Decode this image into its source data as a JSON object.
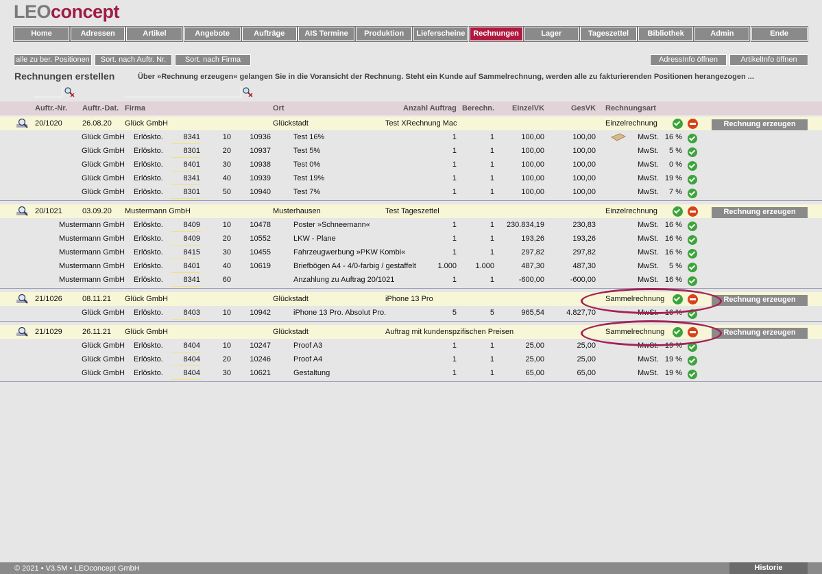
{
  "brand": {
    "part1": "LEO",
    "part2": "concept"
  },
  "nav": [
    "Home",
    "Adressen",
    "Artikel",
    "Angebote",
    "Aufträge",
    "AIS Termine",
    "Produktion",
    "Lieferscheine",
    "Rechnungen",
    "Lager",
    "Tageszettel",
    "Bibliothek",
    "Admin",
    "Ende"
  ],
  "active_tab": "Rechnungen",
  "toolbar": {
    "b1": "alle zu ber. Positionen",
    "b2": "Sort. nach Auftr. Nr.",
    "b3": "Sort. nach Firma",
    "b4": "AdressInfo öffnen",
    "b5": "ArtikelInfo öffnen"
  },
  "page_title": "Rechnungen erstellen",
  "hint": "Über »Rechnung erzeugen« gelangen Sie in die Voransicht der Rechnung. Steht ein Kunde auf Sammelrechnung, werden alle zu fakturierenden Positionen herangezogen ...",
  "columns": {
    "nr": "Auftr.-Nr.",
    "dat": "Auftr.-Dat.",
    "firma": "Firma",
    "ort": "Ort",
    "anz": "Anzahl Auftrag",
    "ber": "Berechn.",
    "evk": "EinzelVK",
    "gvk": "GesVK",
    "art": "Rechnungsart"
  },
  "generate_label": "Rechnung erzeugen",
  "mwst_label": "MwSt.",
  "orders": [
    {
      "nr": "20/1020",
      "dat": "26.08.20",
      "firma": "Glück GmbH",
      "ort": "Glückstadt",
      "projekt": "Test XRechnung Mac",
      "art": "Einzelrechnung",
      "items": [
        {
          "firma": "Glück GmbH",
          "kto": "Erlöskto.",
          "konto": "8341",
          "pos": "10",
          "art": "10936",
          "text": "Test 16%",
          "anz": "1",
          "ber": "1",
          "evk": "100,00",
          "gvk": "100,00",
          "mwst": "16 %"
        },
        {
          "firma": "Glück GmbH",
          "kto": "Erlöskto.",
          "konto": "8301",
          "pos": "20",
          "art": "10937",
          "text": "Test 5%",
          "anz": "1",
          "ber": "1",
          "evk": "100,00",
          "gvk": "100,00",
          "mwst": "5 %"
        },
        {
          "firma": "Glück GmbH",
          "kto": "Erlöskto.",
          "konto": "8401",
          "pos": "30",
          "art": "10938",
          "text": "Test 0%",
          "anz": "1",
          "ber": "1",
          "evk": "100,00",
          "gvk": "100,00",
          "mwst": "0 %"
        },
        {
          "firma": "Glück GmbH",
          "kto": "Erlöskto.",
          "konto": "8341",
          "pos": "40",
          "art": "10939",
          "text": "Test 19%",
          "anz": "1",
          "ber": "1",
          "evk": "100,00",
          "gvk": "100,00",
          "mwst": "19 %"
        },
        {
          "firma": "Glück GmbH",
          "kto": "Erlöskto.",
          "konto": "8301",
          "pos": "50",
          "art": "10940",
          "text": "Test 7%",
          "anz": "1",
          "ber": "1",
          "evk": "100,00",
          "gvk": "100,00",
          "mwst": "7 %"
        }
      ]
    },
    {
      "nr": "20/1021",
      "dat": "03.09.20",
      "firma": "Mustermann GmbH",
      "ort": "Musterhausen",
      "projekt": "Test Tageszettel",
      "art": "Einzelrechnung",
      "items": [
        {
          "firma": "Mustermann GmbH",
          "kto": "Erlöskto.",
          "konto": "8409",
          "pos": "10",
          "art": "10478",
          "text": "Poster »Schneemann«",
          "anz": "1",
          "ber": "1",
          "evk": "230.834,19",
          "gvk": "230,83",
          "mwst": "16 %"
        },
        {
          "firma": "Mustermann GmbH",
          "kto": "Erlöskto.",
          "konto": "8409",
          "pos": "20",
          "art": "10552",
          "text": "LKW - Plane",
          "anz": "1",
          "ber": "1",
          "evk": "193,26",
          "gvk": "193,26",
          "mwst": "16 %"
        },
        {
          "firma": "Mustermann GmbH",
          "kto": "Erlöskto.",
          "konto": "8415",
          "pos": "30",
          "art": "10455",
          "text": "Fahrzeugwerbung »PKW Kombi«",
          "anz": "1",
          "ber": "1",
          "evk": "297,82",
          "gvk": "297,82",
          "mwst": "16 %"
        },
        {
          "firma": "Mustermann GmbH",
          "kto": "Erlöskto.",
          "konto": "8401",
          "pos": "40",
          "art": "10619",
          "text": "Briefbögen A4 - 4/0-farbig / gestaffelt",
          "anz": "1.000",
          "ber": "1.000",
          "evk": "487,30",
          "gvk": "487,30",
          "mwst": "5 %"
        },
        {
          "firma": "Mustermann GmbH",
          "kto": "Erlöskto.",
          "konto": "8341",
          "pos": "60",
          "art": "",
          "text": "Anzahlung zu Auftrag 20/1021",
          "anz": "1",
          "ber": "1",
          "evk": "-600,00",
          "gvk": "-600,00",
          "mwst": "16 %"
        }
      ]
    },
    {
      "nr": "21/1026",
      "dat": "08.11.21",
      "firma": "Glück GmbH",
      "ort": "Glückstadt",
      "projekt": "iPhone 13 Pro",
      "art": "Sammelrechnung",
      "items": [
        {
          "firma": "Glück GmbH",
          "kto": "Erlöskto.",
          "konto": "8403",
          "pos": "10",
          "art": "10942",
          "text": "iPhone 13 Pro. Absolut Pro.",
          "anz": "5",
          "ber": "5",
          "evk": "965,54",
          "gvk": "4.827,70",
          "mwst": "16 %"
        }
      ]
    },
    {
      "nr": "21/1029",
      "dat": "26.11.21",
      "firma": "Glück GmbH",
      "ort": "Glückstadt",
      "projekt": "Auftrag mit kundenspzifischen Preisen",
      "art": "Sammelrechnung",
      "items": [
        {
          "firma": "Glück GmbH",
          "kto": "Erlöskto.",
          "konto": "8404",
          "pos": "10",
          "art": "10247",
          "text": "Proof A3",
          "anz": "1",
          "ber": "1",
          "evk": "25,00",
          "gvk": "25,00",
          "mwst": "19 %"
        },
        {
          "firma": "Glück GmbH",
          "kto": "Erlöskto.",
          "konto": "8404",
          "pos": "20",
          "art": "10246",
          "text": "Proof A4",
          "anz": "1",
          "ber": "1",
          "evk": "25,00",
          "gvk": "25,00",
          "mwst": "19 %"
        },
        {
          "firma": "Glück GmbH",
          "kto": "Erlöskto.",
          "konto": "8404",
          "pos": "30",
          "art": "10621",
          "text": "Gestaltung",
          "anz": "1",
          "ber": "1",
          "evk": "65,00",
          "gvk": "65,00",
          "mwst": "19 %"
        }
      ]
    }
  ],
  "footer": {
    "copy": "© 2021 • V3.5M • LEOconcept GmbH",
    "historie": "Historie"
  },
  "colors": {
    "accent": "#b0173f",
    "nav_bg": "#8a8a8a",
    "order_row": "#f7f7d7",
    "header_row": "#e2d3d8",
    "ok": "#3ba43b",
    "stop": "#d9411b"
  }
}
